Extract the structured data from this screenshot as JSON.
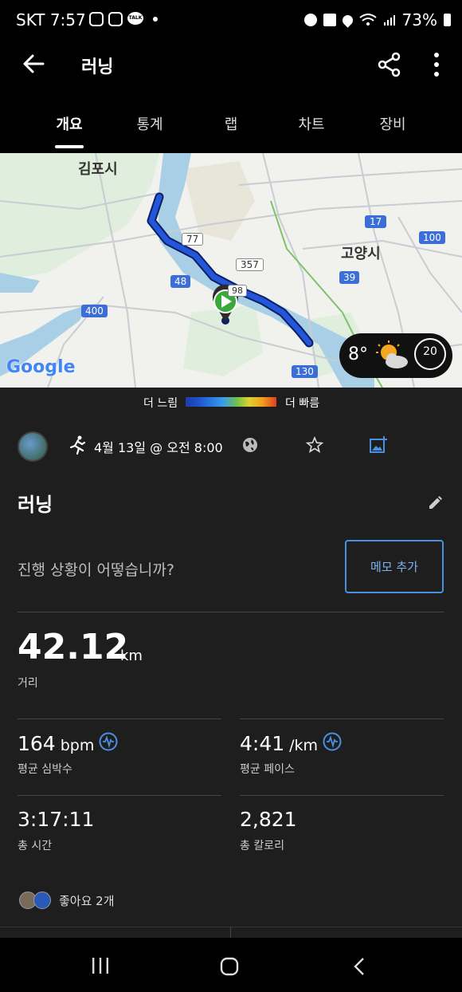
{
  "status_bar": {
    "carrier_time": "SKT 7:57",
    "talk_icon_text": "TALK",
    "battery": "73%"
  },
  "app_bar": {
    "title": "러닝",
    "back_icon": "arrow-left-icon",
    "share_icon": "share-icon",
    "more_icon": "more-vertical-icon"
  },
  "tabs": [
    {
      "label": "개요",
      "active": true
    },
    {
      "label": "통계",
      "active": false
    },
    {
      "label": "랩",
      "active": false
    },
    {
      "label": "차트",
      "active": false
    },
    {
      "label": "장비",
      "active": false
    }
  ],
  "map": {
    "labels": {
      "gimpo": "김포시",
      "goyang": "고양시",
      "google": "Google"
    },
    "road_badges": [
      "17",
      "100",
      "77",
      "357",
      "48",
      "98",
      "39",
      "400",
      "130"
    ],
    "weather": {
      "temperature": "8°",
      "wind": "20"
    }
  },
  "legend": {
    "slow": "더 느림",
    "fast": "더 빠름"
  },
  "activity": {
    "date": "4월 13일 @ 오전 8:00",
    "title": "러닝",
    "prompt": "진행 상황이 어떻습니까?",
    "memo_button": "메모 추가"
  },
  "stats": {
    "distance": {
      "value": "42.12",
      "unit": "km",
      "label": "거리"
    },
    "heart_rate": {
      "value": "164",
      "unit": "bpm",
      "label": "평균 심박수"
    },
    "pace": {
      "value": "4:41",
      "unit": "/km",
      "label": "평균 페이스"
    },
    "time": {
      "value": "3:17:11",
      "label": "총 시간"
    },
    "calories": {
      "value": "2,821",
      "label": "총 칼로리"
    }
  },
  "likes": {
    "text": "좋아요 2개"
  },
  "colors": {
    "accent": "#4a90e2",
    "background": "#1e1e1e",
    "route": "#1e52cc",
    "start_marker": "#3aa83a"
  }
}
